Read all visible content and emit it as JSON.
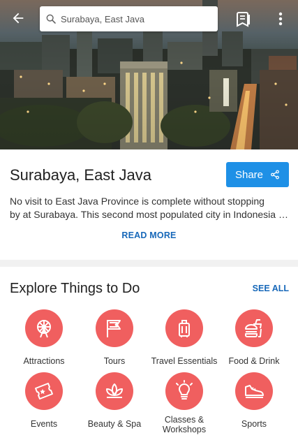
{
  "header": {
    "search_value": "Surabaya, East Java",
    "icons": [
      "back-arrow-icon",
      "search-icon",
      "bookmark-list-icon",
      "more-vert-icon"
    ]
  },
  "destination": {
    "title": "Surabaya, East Java",
    "share_label": "Share",
    "description_line1": "No visit to East Java Province is complete without stopping",
    "description_line2": "by at Surabaya. This second most populated city in Indonesia is a vibrant hub of trade and culture.",
    "read_more": "READ MORE"
  },
  "explore": {
    "title": "Explore Things to Do",
    "see_all": "SEE ALL",
    "accent_color": "#f05f5f",
    "categories": [
      {
        "label": "Attractions",
        "icon": "ferris-wheel-icon"
      },
      {
        "label": "Tours",
        "icon": "flag-icon"
      },
      {
        "label": "Travel Essentials",
        "icon": "luggage-icon"
      },
      {
        "label": "Food & Drink",
        "icon": "burger-drink-icon"
      },
      {
        "label": "Events",
        "icon": "ticket-icon"
      },
      {
        "label": "Beauty & Spa",
        "icon": "lotus-icon"
      },
      {
        "label": "Classes &\nWorkshops",
        "icon": "lightbulb-icon"
      },
      {
        "label": "Sports",
        "icon": "sneaker-icon"
      }
    ]
  },
  "colors": {
    "primary_button": "#1e90e6",
    "link": "#1768b9"
  }
}
